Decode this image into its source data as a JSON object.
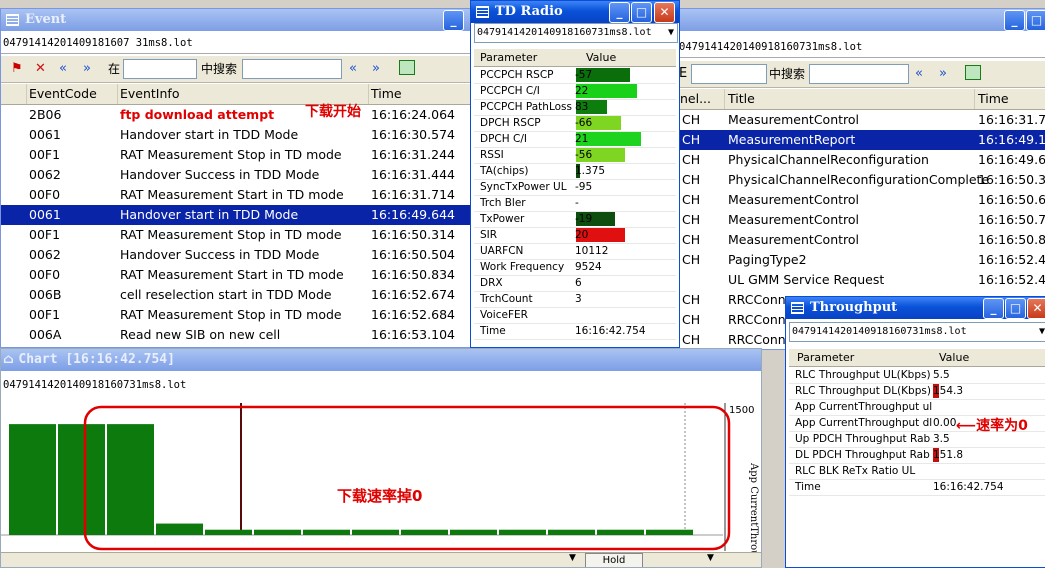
{
  "event": {
    "title": "Event",
    "file": "04791414201409181607 31ms8.lot",
    "toolbar": {
      "search_in_label": "在",
      "search_label": "中搜索",
      "prev": "«",
      "next": "»"
    },
    "columns": [
      "EventCode",
      "EventInfo",
      "Time"
    ],
    "rows": [
      {
        "code": "2B06",
        "info": "ftp download attempt",
        "time": "16:16:24.064",
        "highlight": true
      },
      {
        "code": "0061",
        "info": "Handover start in TDD Mode",
        "time": "16:16:30.574"
      },
      {
        "code": "00F1",
        "info": "RAT Measurement Stop in TD mode",
        "time": "16:16:31.244"
      },
      {
        "code": "0062",
        "info": "Handover Success in TDD Mode",
        "time": "16:16:31.444"
      },
      {
        "code": "00F0",
        "info": "RAT Measurement Start in TD mode",
        "time": "16:16:31.714"
      },
      {
        "code": "0061",
        "info": "Handover start in TDD Mode",
        "time": "16:16:49.644",
        "selected": true
      },
      {
        "code": "00F1",
        "info": "RAT Measurement Stop in TD mode",
        "time": "16:16:50.314"
      },
      {
        "code": "0062",
        "info": "Handover Success in TDD Mode",
        "time": "16:16:50.504"
      },
      {
        "code": "00F0",
        "info": "RAT Measurement Start in TD mode",
        "time": "16:16:50.834"
      },
      {
        "code": "006B",
        "info": "cell reselection start in TDD Mode",
        "time": "16:16:52.674"
      },
      {
        "code": "00F1",
        "info": "RAT Measurement Stop in TD mode",
        "time": "16:16:52.684"
      },
      {
        "code": "006A",
        "info": "Read new SIB on new cell",
        "time": "16:16:53.104"
      }
    ],
    "annotation": "下载开始"
  },
  "td_radio": {
    "title": "TD Radio",
    "file": "0479141420140918160731ms8.lot",
    "columns": [
      "Parameter",
      "Value"
    ],
    "rows": [
      {
        "name": "PCCPCH RSCP",
        "value": "-57",
        "bar": 0.55,
        "color": "#0a6e0a"
      },
      {
        "name": "PCCPCH C/I",
        "value": "22",
        "bar": 0.62,
        "color": "#19d119"
      },
      {
        "name": "PCCPCH PathLoss",
        "value": "83",
        "bar": 0.32,
        "color": "#0d7d0d"
      },
      {
        "name": "DPCH RSCP",
        "value": "-66",
        "bar": 0.46,
        "color": "#7fd622"
      },
      {
        "name": "DPCH C/I",
        "value": "21",
        "bar": 0.66,
        "color": "#1ed31e"
      },
      {
        "name": "RSSI",
        "value": "-56",
        "bar": 0.5,
        "color": "#7fd622"
      },
      {
        "name": "TA(chips)",
        "value": "1.375",
        "bar": 0.04,
        "color": "#0a4d0a"
      },
      {
        "name": "SyncTxPower UL",
        "value": "-95"
      },
      {
        "name": "Trch Bler",
        "value": "-"
      },
      {
        "name": "TxPower",
        "value": "-19",
        "bar": 0.4,
        "color": "#0d4d0d"
      },
      {
        "name": "SIR",
        "value": "20",
        "bar": 0.5,
        "color": "#e01010"
      },
      {
        "name": "UARFCN",
        "value": "10112"
      },
      {
        "name": "Work Frequency",
        "value": "9524"
      },
      {
        "name": "DRX",
        "value": "6"
      },
      {
        "name": "TrchCount",
        "value": "3"
      },
      {
        "name": "VoiceFER",
        "value": ""
      },
      {
        "name": "Time",
        "value": "16:16:42.754"
      }
    ]
  },
  "messages": {
    "file": "0479141420140918160731ms8.lot",
    "toolbar": {
      "search_label": "中搜索",
      "prev": "«",
      "next": "»"
    },
    "columns": [
      "nel...",
      "Title",
      "Time"
    ],
    "rows": [
      {
        "ch": "CH",
        "title": "MeasurementControl",
        "time": "16:16:31.7"
      },
      {
        "ch": "CH",
        "title": "MeasurementReport",
        "time": "16:16:49.1",
        "selected": true
      },
      {
        "ch": "CH",
        "title": "PhysicalChannelReconfiguration",
        "time": "16:16:49.6"
      },
      {
        "ch": "CH",
        "title": "PhysicalChannelReconfigurationComplete",
        "time": "16:16:50.3"
      },
      {
        "ch": "CH",
        "title": "MeasurementControl",
        "time": "16:16:50.6"
      },
      {
        "ch": "CH",
        "title": "MeasurementControl",
        "time": "16:16:50.7"
      },
      {
        "ch": "CH",
        "title": "MeasurementControl",
        "time": "16:16:50.8"
      },
      {
        "ch": "CH",
        "title": "PagingType2",
        "time": "16:16:52.4"
      },
      {
        "ch": "",
        "title": "UL GMM Service Request",
        "time": "16:16:52.4"
      },
      {
        "ch": "CH",
        "title": "RRCConne",
        "time": ""
      },
      {
        "ch": "CH",
        "title": "RRCConne",
        "time": ""
      },
      {
        "ch": "CH",
        "title": "RRCConne",
        "time": ""
      }
    ]
  },
  "chart": {
    "title": "Chart  [16:16:42.754]",
    "file": "0479141420140918160731ms8.lot",
    "axis_max": "1500",
    "axis_label": "App CurrentThrough",
    "annotation": "下载速率掉0",
    "hold_label": "Hold"
  },
  "chart_data": {
    "type": "bar",
    "values": [
      1500,
      1500,
      1500,
      130,
      60,
      60,
      60,
      60,
      60,
      60,
      60,
      60,
      60,
      60
    ],
    "ylim": [
      0,
      1500
    ],
    "ylabel": "App CurrentThrough"
  },
  "throughput": {
    "title": "Throughput",
    "file": "0479141420140918160731ms8.lot",
    "columns": [
      "Parameter",
      "Value"
    ],
    "rows": [
      {
        "name": "RLC Throughput UL(Kbps)",
        "value": "5.5"
      },
      {
        "name": "RLC Throughput DL(Kbps)",
        "value": "154.3",
        "bar": true
      },
      {
        "name": "App CurrentThroughput ul",
        "value": ""
      },
      {
        "name": "App CurrentThroughput dl",
        "value": "0.00"
      },
      {
        "name": "Up PDCH Throughput Rab",
        "value": "3.5"
      },
      {
        "name": "DL PDCH Throughput Rab",
        "value": "151.8",
        "bar": true
      },
      {
        "name": "RLC BLK ReTx Ratio UL",
        "value": ""
      },
      {
        "name": "Time",
        "value": "16:16:42.754"
      }
    ],
    "annotation": "速率为0"
  }
}
